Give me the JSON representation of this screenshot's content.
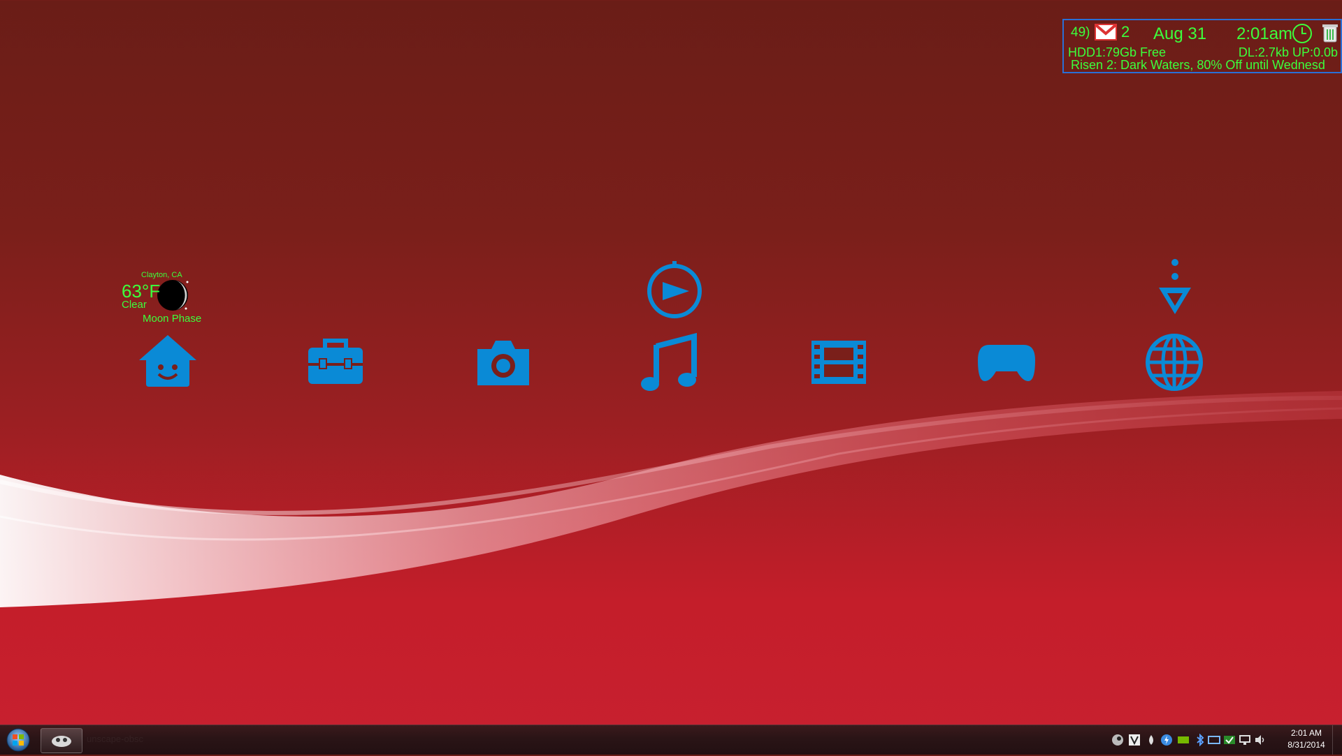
{
  "status_widget": {
    "volume": "49)",
    "mail_count": "2",
    "date": "Aug 31",
    "time": "2:01am",
    "hdd": "HDD1:79Gb Free",
    "network": "DL:2.7kb UP:0.0b",
    "promo": "Risen 2: Dark Waters, 80% Off until Wednesd"
  },
  "weather": {
    "city": "Clayton, CA",
    "temp": "63°F",
    "condition": "Clear",
    "phase_label": "Moon Phase"
  },
  "xmb": {
    "icons": [
      "home-icon",
      "toolbox-icon",
      "camera-icon",
      "music-icon",
      "film-icon",
      "gamepad-icon",
      "globe-icon"
    ],
    "top_icons": [
      "play-circle-icon",
      "download-arrow-icon"
    ],
    "color": "#0a8ad6"
  },
  "taskbar": {
    "clock_time": "2:01 AM",
    "clock_date": "8/31/2014",
    "task_label": "unscape-obsc"
  },
  "colors": {
    "widget_text": "#3cff3c",
    "widget_border": "#2a6fd6",
    "icon": "#0a8ad6"
  }
}
